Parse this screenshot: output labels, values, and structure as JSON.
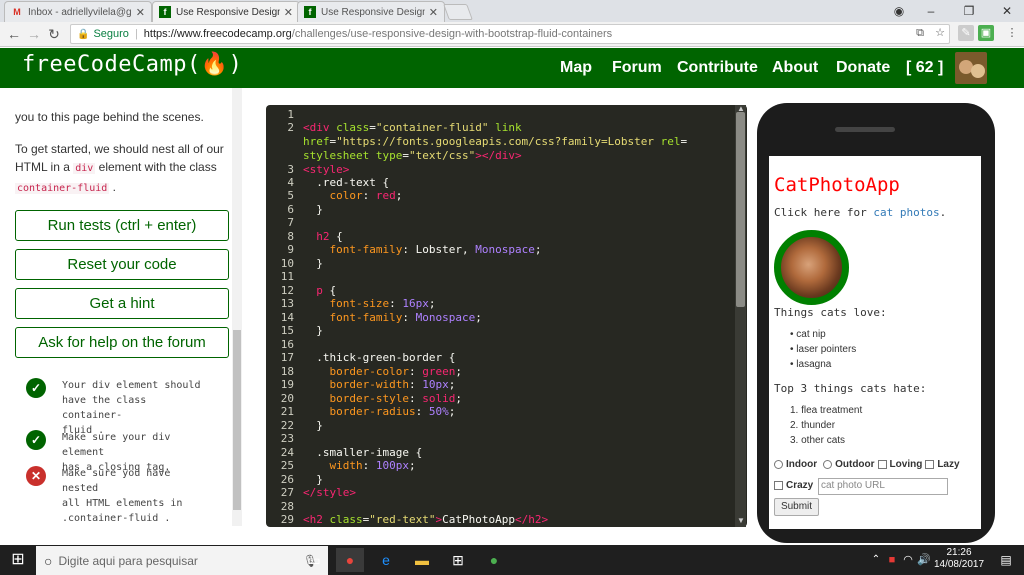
{
  "browser": {
    "tabs": [
      {
        "label": "Inbox - adriellyvilela@gm",
        "favicon": "gmail-icon",
        "active": false
      },
      {
        "label": "Use Responsive Design w",
        "favicon": "fcc-icon",
        "active": true
      },
      {
        "label": "Use Responsive Design w",
        "favicon": "fcc-icon",
        "active": false
      }
    ],
    "security": "Seguro",
    "url_host": "https://www.freecodecamp.org",
    "url_path": "/challenges/use-responsive-design-with-bootstrap-fluid-containers"
  },
  "nav": {
    "logo": "freeCodeCamp(🔥)",
    "links": [
      "Map",
      "Forum",
      "Contribute",
      "About",
      "Donate"
    ],
    "points": "[ 62 ]"
  },
  "instructions": {
    "line1": "you to this page behind the scenes.",
    "p2_part1": "To get started, we should nest all of our",
    "p2_part2": "HTML in a",
    "p2_code1": "div",
    "p2_part3": "element with the class",
    "p2_code2": "container-fluid",
    "p2_end": "."
  },
  "buttons": {
    "run": "Run tests (ctrl + enter)",
    "reset": "Reset your code",
    "hint": "Get a hint",
    "help": "Ask for help on the forum"
  },
  "tests": [
    {
      "status": "pass",
      "lines": [
        "Your div element should",
        "have the class container-",
        "fluid ."
      ]
    },
    {
      "status": "pass",
      "lines": [
        "Make sure your div element",
        "has a closing tag."
      ]
    },
    {
      "status": "fail",
      "lines": [
        "Make sure you have nested",
        "all HTML elements in",
        ".container-fluid ."
      ]
    }
  ],
  "editor": {
    "line_numbers": [
      "1",
      "2",
      "",
      "",
      "3",
      "4",
      "5",
      "6",
      "7",
      "8",
      "9",
      "10",
      "11",
      "12",
      "13",
      "14",
      "15",
      "16",
      "17",
      "18",
      "19",
      "20",
      "21",
      "22",
      "23",
      "24",
      "25",
      "26",
      "27",
      "28",
      "29"
    ]
  },
  "preview": {
    "title": "CatPhotoApp",
    "click_text": "Click here for",
    "click_link": "cat photos",
    "click_end": ".",
    "love_head": "Things cats love:",
    "love": [
      "cat nip",
      "laser pointers",
      "lasagna"
    ],
    "hate_head": "Top 3 things cats hate:",
    "hate": [
      "flea treatment",
      "thunder",
      "other cats"
    ],
    "radios": [
      "Indoor",
      "Outdoor"
    ],
    "checks": [
      "Loving",
      "Lazy",
      "Crazy"
    ],
    "url_placeholder": "cat photo URL",
    "submit": "Submit"
  },
  "taskbar": {
    "search_placeholder": "Digite aqui para pesquisar",
    "time": "21:26",
    "date": "14/08/2017"
  },
  "colors": {
    "fcc_green": "#006400",
    "editor_bg": "#272822",
    "fail": "#c9302c"
  }
}
